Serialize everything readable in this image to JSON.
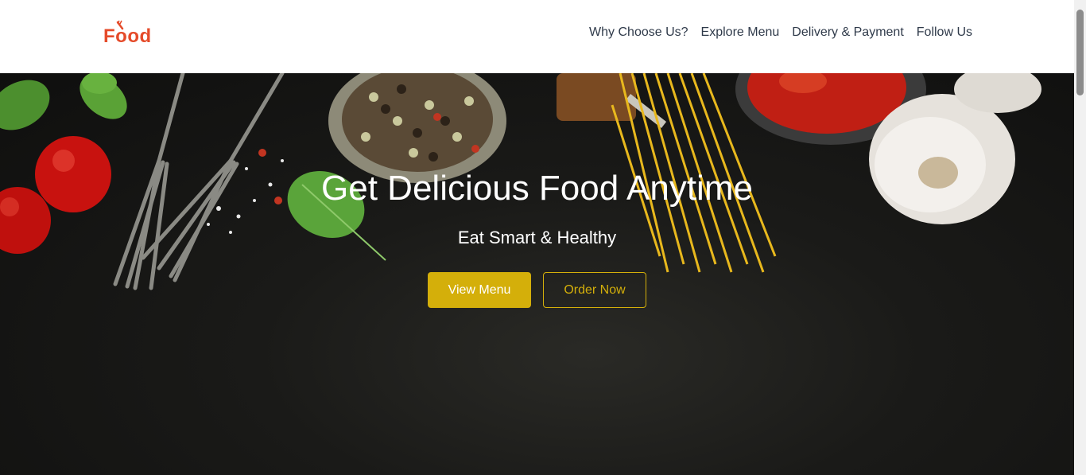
{
  "brand": {
    "logo_text": "Food",
    "accent": "#e54b2a"
  },
  "nav": {
    "items": [
      {
        "label": "Why Choose Us?"
      },
      {
        "label": "Explore Menu"
      },
      {
        "label": "Delivery & Payment"
      },
      {
        "label": "Follow Us"
      }
    ]
  },
  "hero": {
    "title": "Get Delicious Food Anytime",
    "subtitle": "Eat Smart & Healthy",
    "primary_button": "View Menu",
    "secondary_button": "Order Now",
    "button_color": "#d4af0a"
  }
}
